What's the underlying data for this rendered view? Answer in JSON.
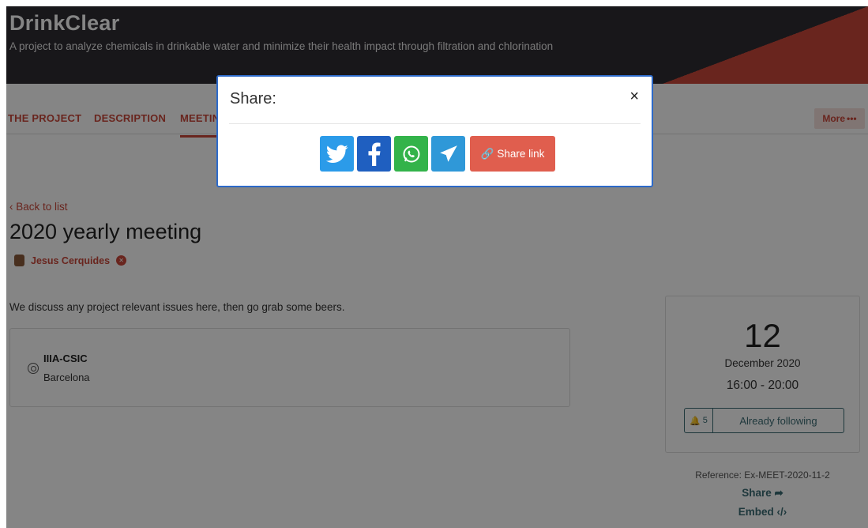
{
  "header": {
    "title": "DrinkClear",
    "description": "A project to analyze chemicals in drinkable water and minimize their health impact through filtration and chlorination"
  },
  "nav": {
    "items": [
      {
        "label": "THE PROJECT"
      },
      {
        "label": "DESCRIPTION"
      },
      {
        "label": "MEETINGS"
      }
    ],
    "more_label": "More"
  },
  "meeting": {
    "back_label": "Back to list",
    "title": "2020 yearly meeting",
    "author": "Jesus Cerquides",
    "description": "We discuss any project relevant issues here, then go grab some beers.",
    "location": {
      "name": "IIIA-CSIC",
      "city": "Barcelona"
    },
    "date": {
      "day": "12",
      "month_year": "December 2020",
      "time": "16:00 - 20:00"
    },
    "follow": {
      "count": "5",
      "label": "Already following"
    },
    "reference": "Reference: Ex-MEET-2020-11-2",
    "share_label": "Share",
    "embed_label": "Embed"
  },
  "modal": {
    "title": "Share:",
    "close_symbol": "×",
    "share_link_label": "Share link",
    "buttons": [
      {
        "icon": "twitter-icon",
        "color": "#2b9be9"
      },
      {
        "icon": "facebook-icon",
        "color": "#1f5fc0"
      },
      {
        "icon": "whatsapp-icon",
        "color": "#33b34a"
      },
      {
        "icon": "telegram-icon",
        "color": "#2f98d8"
      }
    ]
  },
  "colors": {
    "brand": "#c9473a",
    "header_bg": "#2f2c33",
    "link": "#3b6b74",
    "modal_border": "#2d6ac9"
  }
}
